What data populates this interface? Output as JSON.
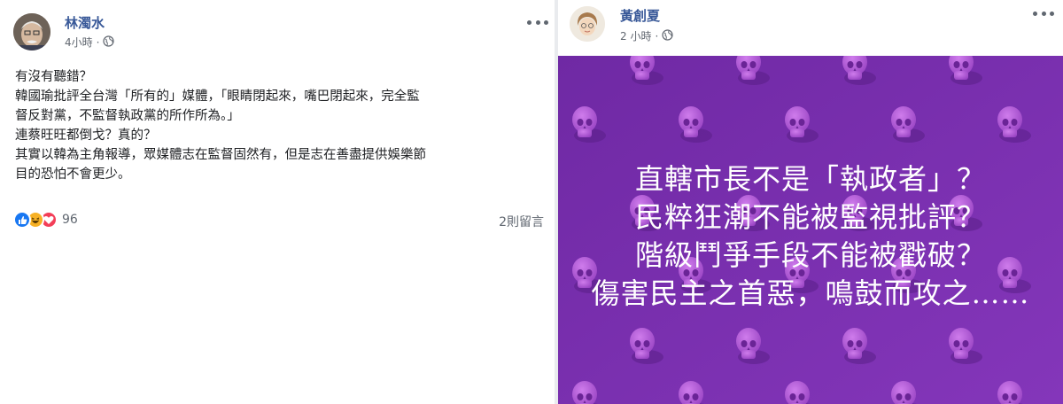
{
  "left_post": {
    "author": "林濁水",
    "time": "4小時",
    "separator": "·",
    "privacy_icon": "globe-icon",
    "lines": [
      "有沒有聽錯？",
      "韓國瑜批評全台灣「所有的」媒體，「眼睛閉起來，嘴巴閉起來，完全監",
      "督反對黨，不監督執政黨的所作所為。」",
      "連蔡旺旺都倒戈？真的？",
      "其實以韓為主角報導，眾媒體志在監督固然有，但是志在善盡提供娛樂節",
      "目的恐怕不會更少。"
    ],
    "reaction_icons": [
      "like-icon",
      "haha-icon",
      "love-icon"
    ],
    "reaction_count": "96",
    "comment_count": "2則留言"
  },
  "right_post": {
    "author": "黃創夏",
    "time": "2 小時",
    "separator": "·",
    "privacy_icon": "globe-icon",
    "image_lines": [
      "直轄市長不是「執政者」？",
      "民粹狂潮不能被監視批評？",
      "階級鬥爭手段不能被戳破？",
      "傷害民主之首惡，鳴鼓而攻之……"
    ]
  },
  "colors": {
    "author_link": "#385898",
    "meta_gray": "#616770",
    "image_purple": "#7b2fb0",
    "skull": "#b45ad8"
  }
}
